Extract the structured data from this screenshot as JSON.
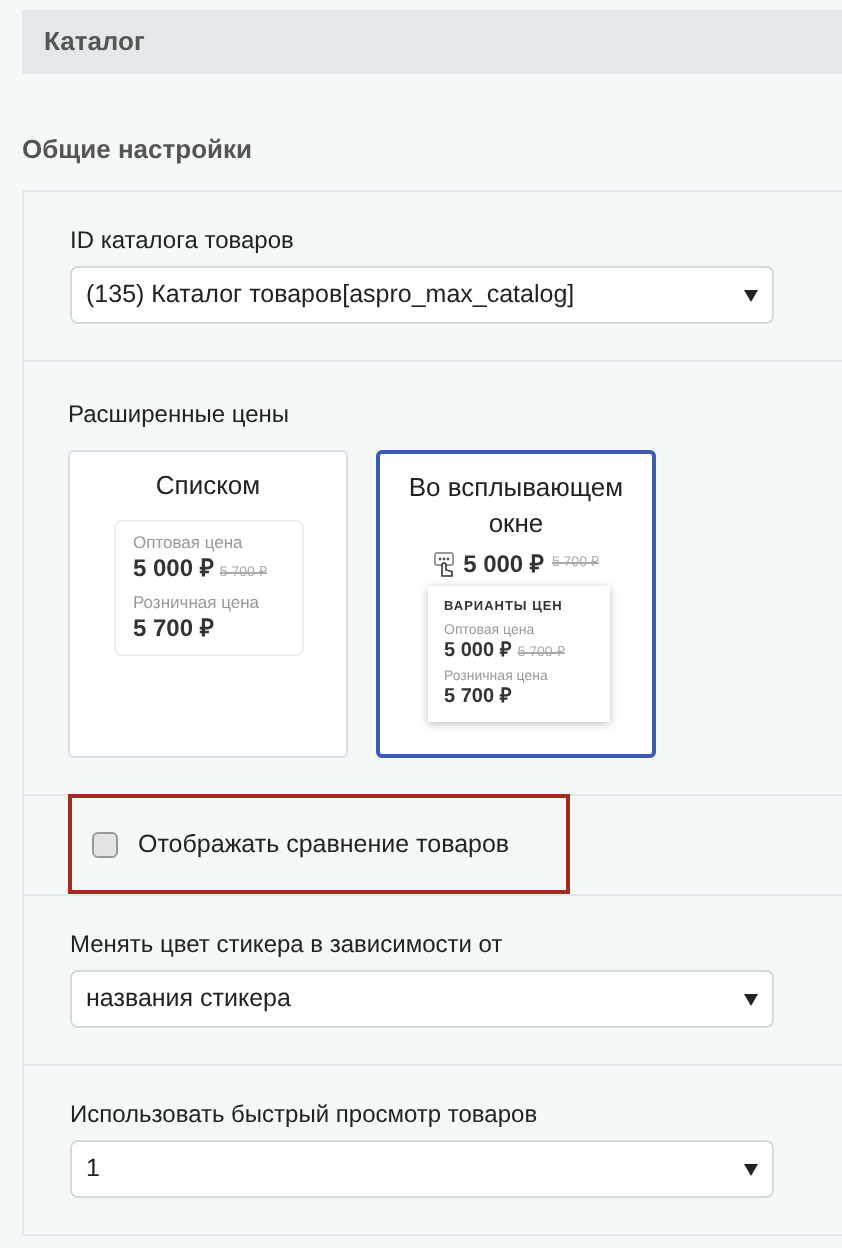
{
  "section_title": "Каталог",
  "group_heading": "Общие настройки",
  "fields": [
    {
      "kind": "select",
      "label": "ID каталога товаров",
      "value": "(135) Каталог товаров[aspro_max_catalog]"
    },
    {
      "kind": "options",
      "label": "Расширенные цены",
      "options": [
        {
          "label": "Списком",
          "selected": false,
          "preview": {
            "kind": "list",
            "rows": [
              {
                "label": "Оптовая цена",
                "price": "5 000 ₽",
                "old_price": "5 700 ₽"
              },
              {
                "label": "Розничная цена",
                "price": "5 700 ₽"
              }
            ]
          }
        },
        {
          "label": "Во всплывающем окне",
          "selected": true,
          "preview": {
            "kind": "popup",
            "price": "5 000 ₽",
            "old_price": "5 700 ₽",
            "popup_title": "ВАРИАНТЫ ЦЕН",
            "rows": [
              {
                "label": "Оптовая цена",
                "price": "5 000 ₽",
                "old_price": "5 700 ₽"
              },
              {
                "label": "Розничная цена",
                "price": "5 700 ₽"
              }
            ]
          }
        }
      ]
    },
    {
      "kind": "checkbox",
      "label": "Отображать сравнение товаров",
      "checked": false,
      "highlighted": true
    },
    {
      "kind": "select",
      "label": "Менять цвет стикера в зависимости от",
      "value": "названия стикера"
    },
    {
      "kind": "select",
      "label": "Использовать быстрый просмотр товаров",
      "value": "1"
    }
  ]
}
